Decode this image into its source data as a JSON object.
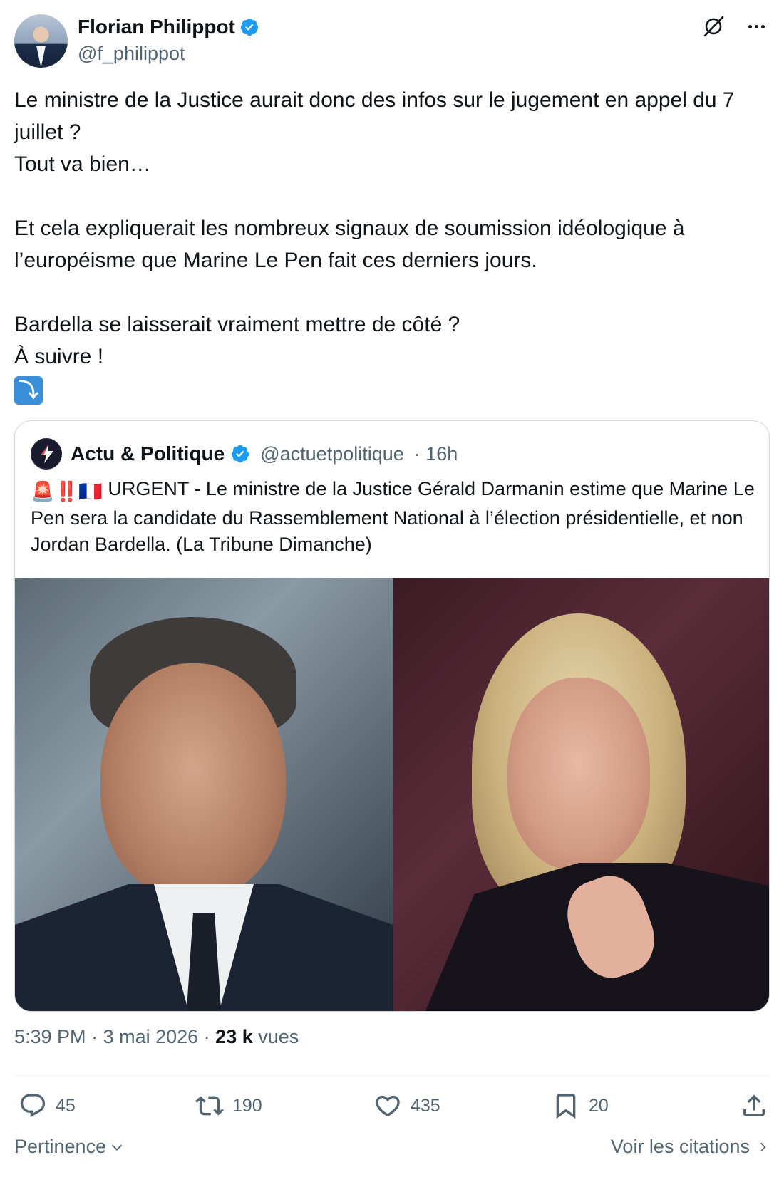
{
  "author": {
    "display_name": "Florian Philippot",
    "handle": "@f_philippot"
  },
  "tweet": {
    "lines": [
      "Le ministre de la Justice aurait donc des infos sur le jugement en appel du 7 juillet ?",
      "Tout va bien…",
      "Et cela expliquerait les nombreux signaux de soumission idéologique à l’européisme que Marine Le Pen fait ces derniers jours.",
      "Bardella se laisserait vraiment mettre de côté ?",
      "À suivre !"
    ],
    "arrow_emoji": "⤵"
  },
  "quote": {
    "display_name": "Actu & Politique",
    "handle": "@actuetpolitique",
    "time": "· 16h",
    "emojis": "🚨‼️🇫🇷",
    "text": "URGENT - Le ministre de la Justice Gérald Darmanin estime que Marine Le Pen sera la candidate du Rassemblement National à l’élection présidentielle, et non Jordan Bardella. (La Tribune Dimanche)"
  },
  "meta": {
    "time": "5:39 PM",
    "date": "· 3 mai 2026 ·",
    "views_count": "23 k",
    "views_label": "vues"
  },
  "actions": {
    "replies": "45",
    "retweets": "190",
    "likes": "435",
    "bookmarks": "20"
  },
  "footer": {
    "sort_label": "Pertinence",
    "quotes_label": "Voir les citations"
  },
  "colors": {
    "text": "#0f1419",
    "secondary": "#536471",
    "verified": "#1d9bf0",
    "border": "#cfd9de"
  }
}
